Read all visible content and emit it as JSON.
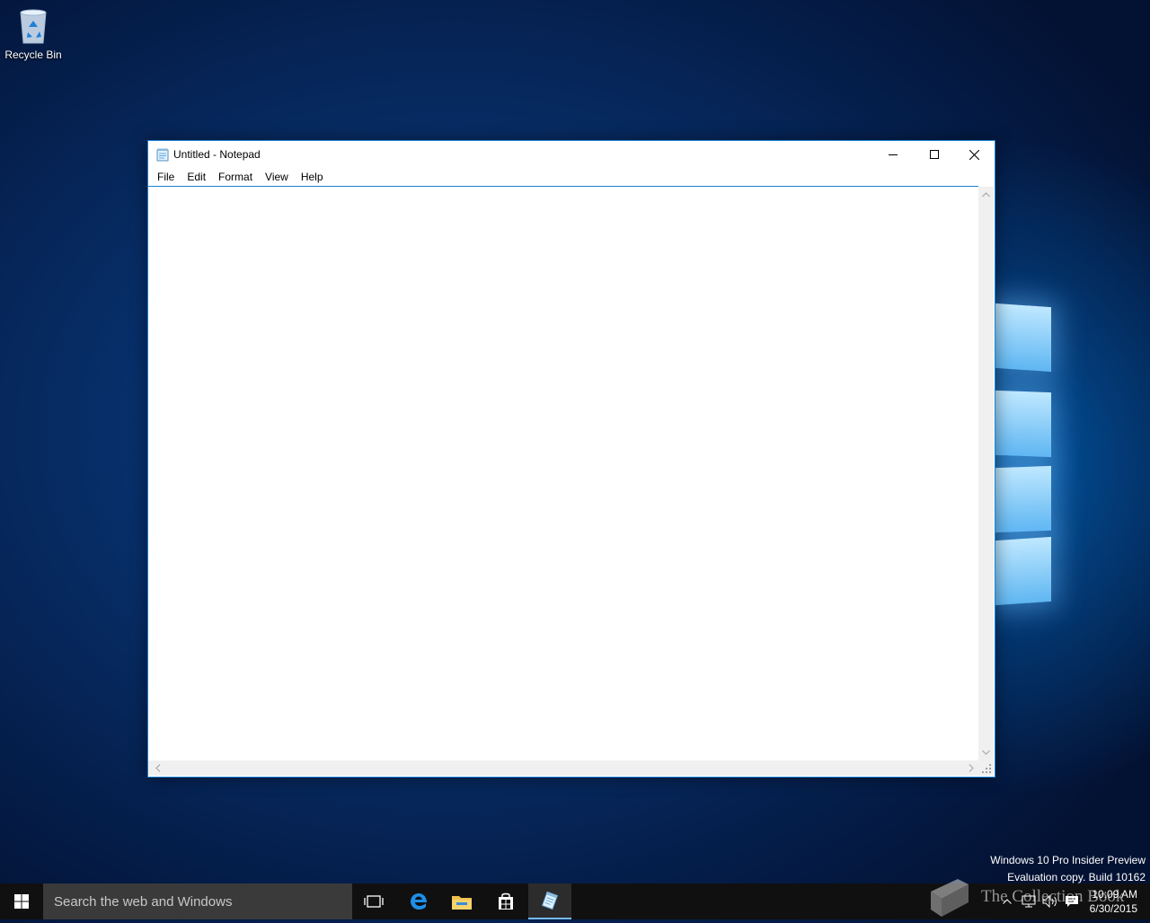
{
  "desktop": {
    "icons": [
      {
        "label": "Recycle Bin",
        "icon": "recycle-bin-icon"
      }
    ]
  },
  "window": {
    "title": "Untitled - Notepad",
    "icon": "notepad-icon",
    "controls": {
      "minimize": "minimize-icon",
      "maximize": "maximize-icon",
      "close": "close-icon"
    },
    "menu": [
      {
        "label": "File"
      },
      {
        "label": "Edit"
      },
      {
        "label": "Format"
      },
      {
        "label": "View"
      },
      {
        "label": "Help"
      }
    ],
    "document_text": ""
  },
  "watermark": {
    "line1": "Windows 10 Pro Insider Preview",
    "line2": "Evaluation copy. Build 10162"
  },
  "taskbar": {
    "search_placeholder": "Search the web and Windows",
    "pinned": [
      "task-view-icon",
      "edge-icon",
      "file-explorer-icon",
      "store-icon",
      "notepad-icon"
    ],
    "tray_icons": [
      "chevron-up-icon",
      "network-icon",
      "volume-icon",
      "action-center-icon"
    ],
    "time": "10:09 AM",
    "date": "6/30/2015",
    "overlay_text": "The Collection Book"
  },
  "colors": {
    "accent": "#1883d7",
    "taskbar": "#101010",
    "search_box": "#3a3a3a"
  }
}
